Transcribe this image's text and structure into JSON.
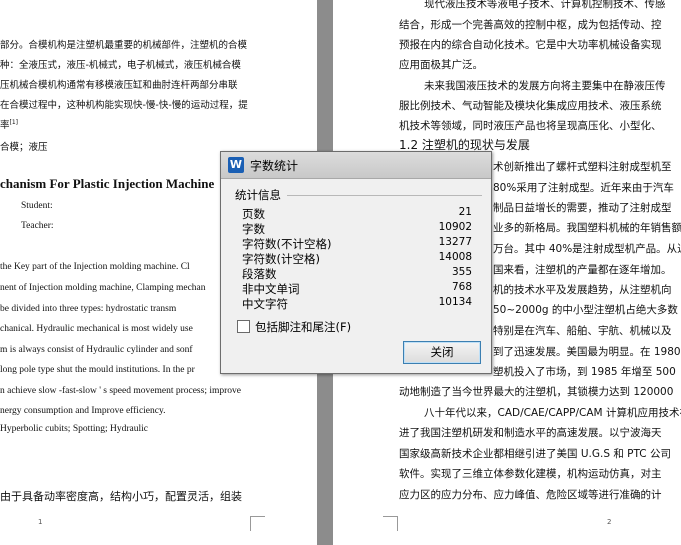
{
  "left_page": {
    "lines": [
      "部分。合模机构是注塑机最重要的机械部件，注塑机的合模",
      "种：全液压式，液压-机械式，电子机械式，液压机械合模",
      "压机械合模机构通常有移模液压缸和曲肘连杆两部分串联",
      "在合模过程中，这种机构能实现快-慢-快-慢的运动过程，提",
      "率",
      "合模；液压"
    ],
    "citation": "[1]",
    "title": "chanism For Plastic Injection Machine",
    "student_label": "Student:",
    "teacher_label": "Teacher:",
    "abstract_lines": [
      "the Key part of the Injection molding machine. Cl",
      "nent of Injection molding machine, Clamping mechan",
      "be divided into three types: hydrostatic transm",
      "chanical. Hydraulic mechanical is most widely use",
      "m    is always consist of    Hydraulic cylinder and sonf",
      "long pole type shut the mould institutions. In the pr",
      "n achieve slow -fast-slow ' s speed movement process; improve",
      "nergy consumption and Improve efficiency.",
      "Hyperbolic cubits; Spotting; Hydraulic"
    ],
    "bottom_line": "由于具备动率密度高，结构小巧，配置灵活，组装",
    "page_number": "1"
  },
  "right_page": {
    "lines_top": [
      "现代液压技术等液电子技术、计算机控制技术、传感",
      "结合，形成一个完善高效的控制中枢，成为包括传动、控",
      "预报在内的综合自动化技术。它是中大功率机械设备实现",
      "应用面极其广泛。",
      "未来我国液压技术的发展方向将主要集中在静液压传",
      "服比例技术、气动智能及模块化集成应用技术、液压系统",
      "机技术等领域，同时液压产品也将呈现高压化、小型化、"
    ],
    "section_heading": "1.2  注塑机的现状与发展",
    "lines_mid": [
      "术创新推出了螺杆式塑料注射成型机至",
      "80%采用了注射成型。近年来由于汽车",
      "制品日益增长的需要，推动了注射成型",
      "业多的新格局。我国塑料机械的年销售额",
      "万台。其中 40%是注射成型机产品。从近",
      "国来看，注塑机的产量都在逐年增加。",
      "机的技术水平及发展趋势，从注塑机向",
      "50~2000g 的中小型注塑机占绝大多数",
      "特别是在汽车、船舶、宇航、机械以及",
      "到了迅速发展。美国最为明显。在 1980 年"
    ],
    "lines_bottom": [
      "塑机投入了市场，到 1985 年增至 500",
      "动地制造了当今世界最大的注塑机，其锁模力达到 120000",
      "八十年代以来，CAD/CAE/CAPP/CAM 计算机应用技术在",
      "进了我国注塑机研发和制造水平的高速发展。以宁波海天",
      "国家级高新技术企业都相继引进了美国 U.G.S 和 PTC 公司",
      "软件。实现了三维立体参数化建模，机构运动仿真，对主",
      "应力区的应力分布、应力峰值、危险区域等进行准确的计"
    ],
    "page_number": "2"
  },
  "dialog": {
    "title": "字数统计",
    "app_icon": "W",
    "group_label": "统计信息",
    "stats": [
      {
        "label": "页数",
        "value": "21"
      },
      {
        "label": "字数",
        "value": "10902"
      },
      {
        "label": "字符数(不计空格)",
        "value": "13277"
      },
      {
        "label": "字符数(计空格)",
        "value": "14008"
      },
      {
        "label": "段落数",
        "value": "355"
      },
      {
        "label": "非中文单词",
        "value": "768"
      },
      {
        "label": "中文字符",
        "value": "10134"
      }
    ],
    "include_notes_label": "包括脚注和尾注(F)",
    "close_label": "关闭"
  },
  "colors": {
    "background": "#8c8c8c",
    "dialog_bg": "#f0f0f0",
    "icon_blue": "#1a5fb4"
  }
}
